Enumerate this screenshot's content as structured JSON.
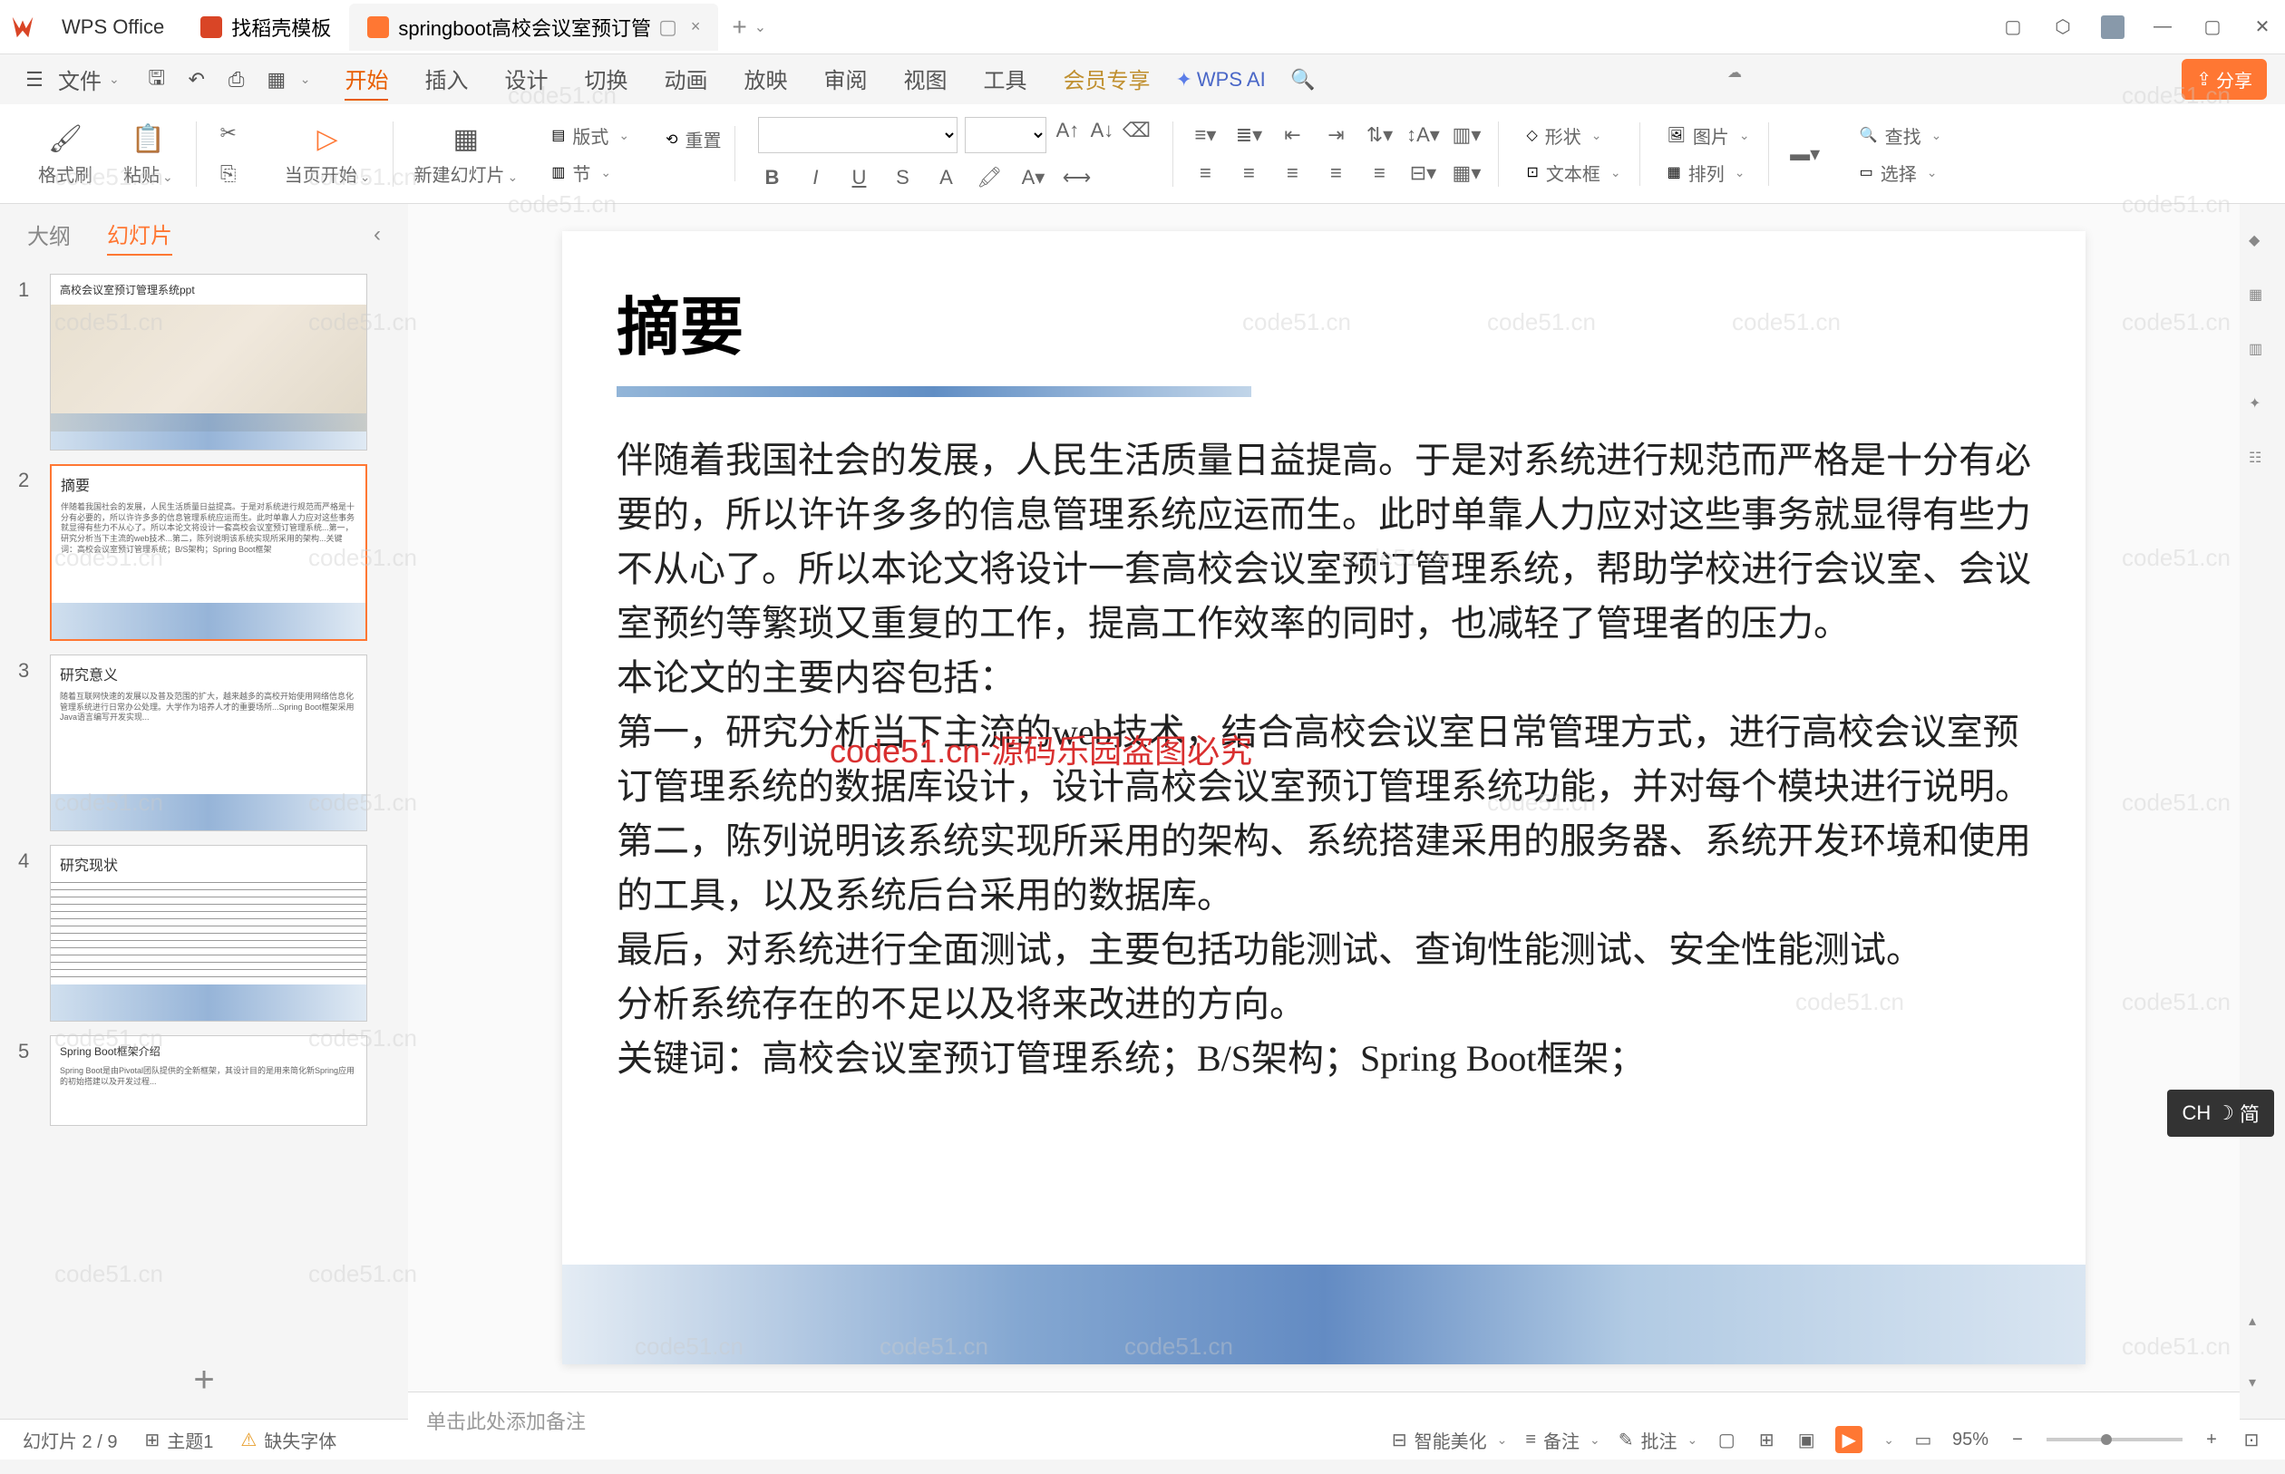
{
  "titlebar": {
    "app_name": "WPS Office",
    "tabs": [
      {
        "label": "找稻壳模板"
      },
      {
        "label": "springboot高校会议室预订管"
      }
    ],
    "tab_close": "×",
    "tab_add": "+"
  },
  "menubar": {
    "file_label": "文件",
    "tabs": [
      "开始",
      "插入",
      "设计",
      "切换",
      "动画",
      "放映",
      "审阅",
      "视图",
      "工具",
      "会员专享"
    ],
    "active_tab": "开始",
    "wps_ai": "WPS AI",
    "share": "分享"
  },
  "ribbon": {
    "format_brush": "格式刷",
    "paste": "粘贴",
    "from_current": "当页开始",
    "new_slide": "新建幻灯片",
    "layout": "版式",
    "section": "节",
    "reset": "重置",
    "shape": "形状",
    "picture": "图片",
    "textbox": "文本框",
    "arrange": "排列",
    "find": "查找",
    "select": "选择"
  },
  "sidebar": {
    "tabs": [
      "大纲",
      "幻灯片"
    ],
    "active_tab": "幻灯片",
    "slides": [
      {
        "num": "1",
        "title": "高校会议室预订管理系统ppt"
      },
      {
        "num": "2",
        "title": "摘要"
      },
      {
        "num": "3",
        "title": "研究意义"
      },
      {
        "num": "4",
        "title": "研究现状"
      },
      {
        "num": "5",
        "title": "Spring Boot框架介绍"
      }
    ]
  },
  "slide": {
    "title": "摘要",
    "content": "伴随着我国社会的发展，人民生活质量日益提高。于是对系统进行规范而严格是十分有必要的，所以许许多多的信息管理系统应运而生。此时单靠人力应对这些事务就显得有些力不从心了。所以本论文将设计一套高校会议室预订管理系统，帮助学校进行会议室、会议室预约等繁琐又重复的工作，提高工作效率的同时，也减轻了管理者的压力。\n本论文的主要内容包括：\n第一，研究分析当下主流的web技术，结合高校会议室日常管理方式，进行高校会议室预订管理系统的数据库设计，设计高校会议室预订管理系统功能，并对每个模块进行说明。\n第二，陈列说明该系统实现所采用的架构、系统搭建采用的服务器、系统开发环境和使用的工具，以及系统后台采用的数据库。\n最后，对系统进行全面测试，主要包括功能测试、查询性能测试、安全性能测试。\n分析系统存在的不足以及将来改进的方向。\n关键词：高校会议室预订管理系统；B/S架构；Spring Boot框架；"
  },
  "watermark_center": "code51.cn-源码乐园盗图必究",
  "watermark_text": "code51.cn",
  "notes": "单击此处添加备注",
  "statusbar": {
    "slide_count": "幻灯片 2 / 9",
    "theme": "主题1",
    "missing_fonts": "缺失字体",
    "beautify": "智能美化",
    "notes": "备注",
    "review": "批注",
    "zoom": "95%"
  },
  "ime": {
    "lang": "CH",
    "mode": "简"
  }
}
